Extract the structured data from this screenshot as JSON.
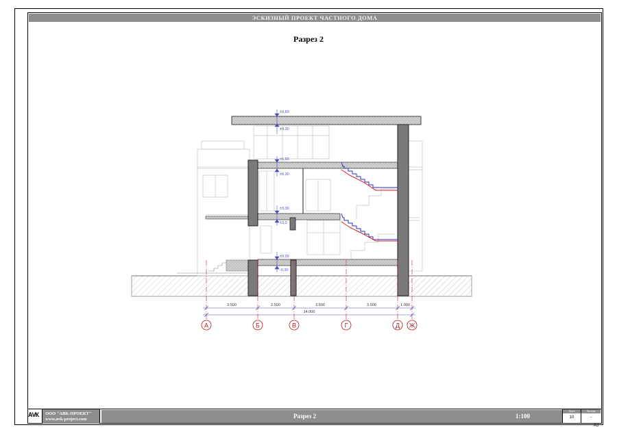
{
  "header": {
    "project_title": "ЭСКИЗНЫЙ ПРОЕКТ ЧАСТНОГО ДОМА"
  },
  "drawing": {
    "title": "Разрез 2",
    "elevations": [
      "±9,60",
      "±9,30",
      "±6,60",
      "±6,30",
      "±3,30",
      "±3,0",
      "±0,00",
      "-0,30"
    ],
    "segment_dims": [
      "3.500",
      "2.500",
      "3.500",
      "3.500",
      "1.000"
    ],
    "total_dim": "14.000",
    "axes": [
      "А",
      "Б",
      "В",
      "Г",
      "Д",
      "Ж"
    ]
  },
  "footer": {
    "logo": "АVК",
    "company": "ООО \"АВК-ПРОЕКТ\"",
    "website": "www.avk-project.com",
    "sheet_name": "Разрез 2",
    "scale": "1:100",
    "sheet_label": "Лист",
    "sheet_number": "10",
    "sheets_label": "Листов",
    "sheets_total": "-",
    "format": "А3"
  },
  "colors": {
    "band": "#8e8e8e",
    "stair_red": "#d81818",
    "stair_blue": "#2a2acc",
    "axis_red": "#b01818",
    "dim_blue": "#4a4acc"
  }
}
